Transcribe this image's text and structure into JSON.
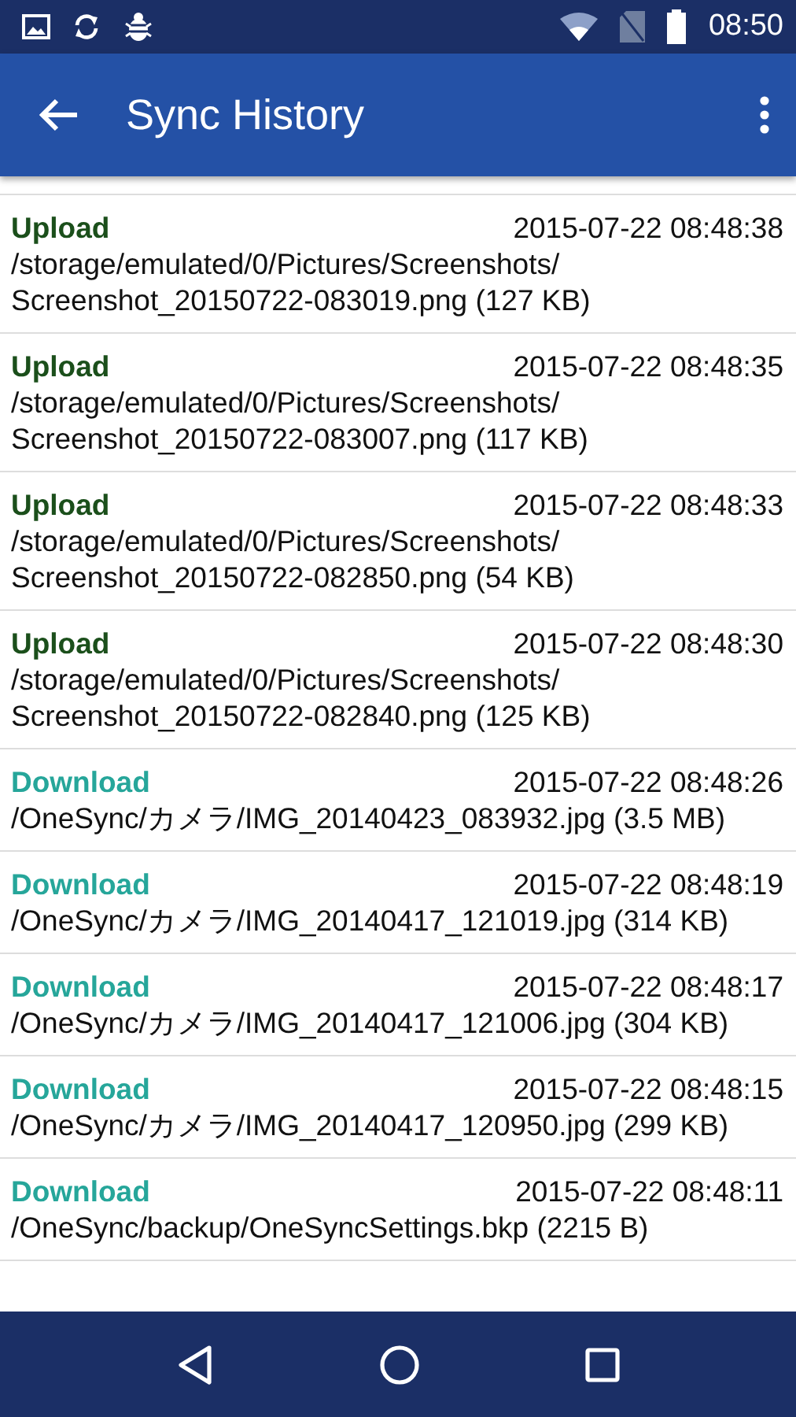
{
  "status_bar": {
    "time": "08:50"
  },
  "app_bar": {
    "title": "Sync History"
  },
  "history": [
    {
      "kind": "upload",
      "action": "Upload",
      "time": "2015-07-22 08:48:38",
      "path": "/storage/emulated/0/Pictures/Screenshots/Screenshot_20150722-083019.png (127 KB)"
    },
    {
      "kind": "upload",
      "action": "Upload",
      "time": "2015-07-22 08:48:35",
      "path": "/storage/emulated/0/Pictures/Screenshots/Screenshot_20150722-083007.png (117 KB)"
    },
    {
      "kind": "upload",
      "action": "Upload",
      "time": "2015-07-22 08:48:33",
      "path": "/storage/emulated/0/Pictures/Screenshots/Screenshot_20150722-082850.png (54 KB)"
    },
    {
      "kind": "upload",
      "action": "Upload",
      "time": "2015-07-22 08:48:30",
      "path": "/storage/emulated/0/Pictures/Screenshots/Screenshot_20150722-082840.png (125 KB)"
    },
    {
      "kind": "download",
      "action": "Download",
      "time": "2015-07-22 08:48:26",
      "path": "/OneSync/カメラ/IMG_20140423_083932.jpg (3.5 MB)"
    },
    {
      "kind": "download",
      "action": "Download",
      "time": "2015-07-22 08:48:19",
      "path": "/OneSync/カメラ/IMG_20140417_121019.jpg (314 KB)"
    },
    {
      "kind": "download",
      "action": "Download",
      "time": "2015-07-22 08:48:17",
      "path": "/OneSync/カメラ/IMG_20140417_121006.jpg (304 KB)"
    },
    {
      "kind": "download",
      "action": "Download",
      "time": "2015-07-22 08:48:15",
      "path": "/OneSync/カメラ/IMG_20140417_120950.jpg (299 KB)"
    },
    {
      "kind": "download",
      "action": "Download",
      "time": "2015-07-22 08:48:11",
      "path": "/OneSync/backup/OneSyncSettings.bkp (2215 B)"
    }
  ]
}
